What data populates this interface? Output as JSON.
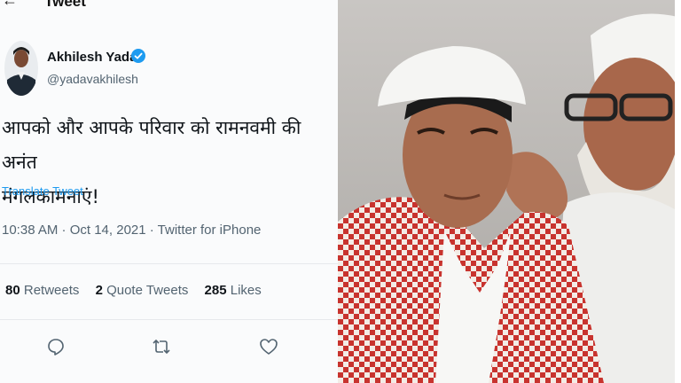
{
  "header": {
    "title": "Tweet",
    "back_icon": "back-arrow-icon"
  },
  "author": {
    "name": "Akhilesh Yadav",
    "handle": "@yadavakhilesh",
    "verified_icon": "verified-badge-icon",
    "verified_color": "#1d9bf0"
  },
  "tweet": {
    "text_line1": "आपको और आपके परिवार को रामनवमी की अनंत",
    "text_line2": "मंगलकामनाएं!",
    "translate_label": "Translate Tweet",
    "timestamp": "10:38 AM · Oct 14, 2021 · Twitter for iPhone"
  },
  "stats": {
    "retweets_count": "80",
    "retweets_label": "Retweets",
    "quotes_count": "2",
    "quotes_label": "Quote Tweets",
    "likes_count": "285",
    "likes_label": "Likes"
  },
  "actions": {
    "reply_icon": "reply-icon",
    "retweet_icon": "retweet-icon",
    "like_icon": "like-heart-icon"
  },
  "colors": {
    "link": "#1d9bf0",
    "secondary_text": "#536471",
    "keffiyeh_red": "#c8332e"
  }
}
